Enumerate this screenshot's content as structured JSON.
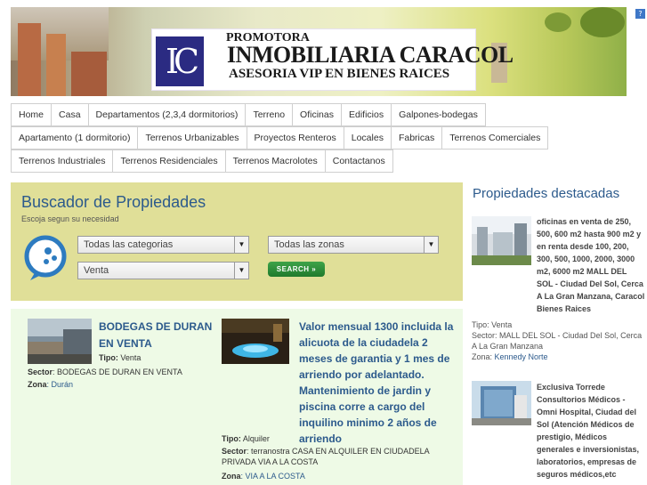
{
  "logo": {
    "mark": "IC",
    "line1": "PROMOTORA",
    "line2": "INMOBILIARIA CARACOL",
    "line3": "ASESORIA VIP EN BIENES RAICES"
  },
  "nav": {
    "row1": [
      "Home",
      "Casa",
      "Departamentos (2,3,4 dormitorios)",
      "Terreno",
      "Oficinas",
      "Edificios",
      "Galpones-bodegas"
    ],
    "row2": [
      "Apartamento (1 dormitorio)",
      "Terrenos Urbanizables",
      "Proyectos Renteros",
      "Locales",
      "Fabricas",
      "Terrenos Comerciales"
    ],
    "row3": [
      "Terrenos Industriales",
      "Terrenos Residenciales",
      "Terrenos Macrolotes",
      "Contactanos"
    ]
  },
  "search": {
    "title": "Buscador de Propiedades",
    "subtitle": "Escoja segun su necesidad",
    "category": "Todas las categorias",
    "zone": "Todas las zonas",
    "operation": "Venta",
    "button": "SEARCH »"
  },
  "listings": [
    {
      "title": "BODEGAS DE DURAN EN VENTA",
      "tipo_label": "Tipo:",
      "tipo": "Venta",
      "sector_label": "Sector",
      "sector": ": BODEGAS DE DURAN EN VENTA",
      "zona_label": "Zona",
      "zona": ": Durán"
    },
    {
      "title": "Valor mensual 1300 incluida la alicuota de la ciudadela 2 meses de garantia y 1 mes de arriendo por adelantado. Mantenimiento de jardin y piscina corre a cargo del inquilino minimo 2 años de arriendo",
      "tipo_label": "Tipo:",
      "tipo": "Alquiler",
      "sector_label": "Sector",
      "sector": ": terranostra CASA EN ALQUILER EN CIUDADELA PRIVADA VIA A LA COSTA",
      "zona_label": "Zona",
      "zona": ": VIA A LA COSTA"
    }
  ],
  "featured": {
    "title": "Propiedades destacadas",
    "items": [
      {
        "title": "oficinas en venta de 250, 500, 600 m2 hasta 900 m2 y en renta desde 100, 200, 300, 500, 1000, 2000, 3000 m2, 6000 m2 MALL DEL SOL - Ciudad Del Sol, Cerca A La Gran Manzana, Caracol Bienes Raices",
        "tipo": "Tipo: Venta",
        "sector": "Sector: MALL DEL SOL - Ciudad Del Sol, Cerca A La Gran Manzana",
        "zona_label": "Zona: ",
        "zona": "Kennedy Norte"
      },
      {
        "title": "Exclusiva Torrede Consultorios Médicos - Omni Hospital, Ciudad del Sol (Atención Médicos de prestigio, Médicos generales e inversionistas, laboratorios, empresas de seguros médicos,etc"
      }
    ]
  },
  "colors": {
    "accent": "#2c5a8c",
    "search_bg": "#e0df98",
    "listing_bg": "#eefae6",
    "button": "#2a8f38"
  }
}
